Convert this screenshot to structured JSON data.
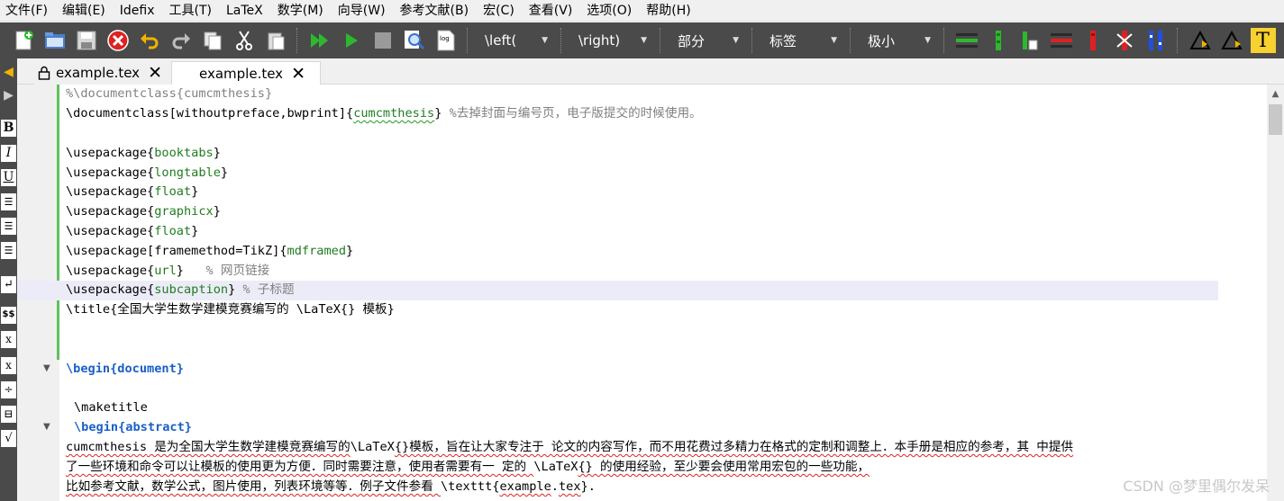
{
  "menu": [
    "文件(F)",
    "编辑(E)",
    "Idefix",
    "工具(T)",
    "LaTeX",
    "数学(M)",
    "向导(W)",
    "参考文献(B)",
    "宏(C)",
    "查看(V)",
    "选项(O)",
    "帮助(H)"
  ],
  "toolbar": {
    "combo_left": "\\left(",
    "combo_right": "\\right)",
    "combo_section": "部分",
    "combo_label": "标签",
    "combo_size": "极小",
    "log_label": "log",
    "t_label": "T"
  },
  "leftbar": {
    "bold": "B",
    "italic": "I",
    "underline": "U",
    "dollar": "$$",
    "sub": "x",
    "sup": "x"
  },
  "tabs": [
    {
      "label": "example.tex"
    },
    {
      "label": "example.tex"
    }
  ],
  "code": {
    "l1": "%\\documentclass{cumcmthesis}",
    "l2_cmd": "\\documentclass",
    "l2_opt": "[withoutpreface,bwprint]{",
    "l2_arg": "cumcmthesis",
    "l2_close": "}",
    "l2_cmt": " %去掉封面与编号页，电子版提交的时候使用。",
    "pkg1": "booktabs",
    "pkg2": "longtable",
    "pkg3": "float",
    "pkg4": "graphicx",
    "pkg5": "float",
    "pkg6_opt": "[framemethod=TikZ]",
    "pkg6": "mdframed",
    "pkg7": "url",
    "pkg7_cmt": "   % 网页链接",
    "pkg8": "subcaption",
    "pkg8_cmt": " % 子标题",
    "usepackage": "\\usepackage",
    "title_cmd": "\\title",
    "title_text": "{全国大学生数学建模竞赛编写的 ",
    "latex_cmd": "\\LaTeX",
    "title_end": "{} 模板}",
    "begin": "\\begin",
    "document": "{document}",
    "maketitle": "\\maketitle",
    "abstract": "{abstract}",
    "p1a": "cumcmthesis",
    "p1b": " 是为全国大学生数学建模竞赛编写的",
    "p1c": "\\LaTeX",
    "p1d": "{}模板，旨在让大家专注于 论文的内容写作，而不用花费过多精力在格式的定制和调整上．本手册是相应的参考，其 中提供",
    "p2a": "了一些环境和命令可以让模板的使用更为方便．同时需要注意，使用者需要有一 定的 ",
    "p2b": "\\LaTeX",
    "p2c": "{} 的使用经验，至少要会使用常用宏包的一些功能，",
    "p3a": "比如参考文献，数学公式，图片使用，列表环境等等．例子文件参看 ",
    "p3b": "\\texttt",
    "p3c": "{",
    "p3d": "example",
    "p3e": ".",
    "p3f": "tex",
    "p3g": "}."
  },
  "watermark": "CSDN @梦里偶尔发呆",
  "colors": {
    "toolbar_bg": "#4a4a4a",
    "keyword_green": "#1f7d1f",
    "keyword_blue": "#1a5fc8",
    "comment_gray": "#808080",
    "gutter_green": "#5fc15f"
  }
}
